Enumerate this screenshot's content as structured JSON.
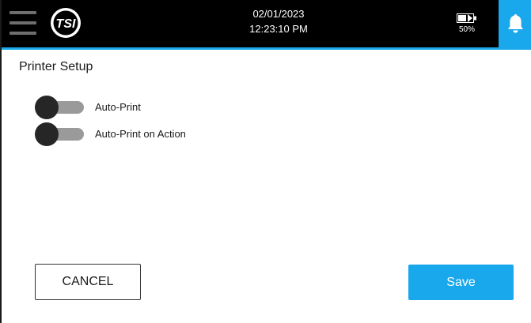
{
  "header": {
    "date": "02/01/2023",
    "time": "12:23:10 PM",
    "battery_percent": "50%",
    "logo_text": "TSI",
    "accent_color": "#1aa8ec",
    "icons": {
      "menu": "hamburger-menu-icon",
      "battery": "battery-icon",
      "notifications": "bell-icon"
    }
  },
  "page": {
    "title": "Printer Setup"
  },
  "toggles": [
    {
      "label": "Auto-Print",
      "enabled": false
    },
    {
      "label": "Auto-Print on Action",
      "enabled": false
    }
  ],
  "actions": {
    "cancel_label": "CANCEL",
    "save_label": "Save"
  }
}
